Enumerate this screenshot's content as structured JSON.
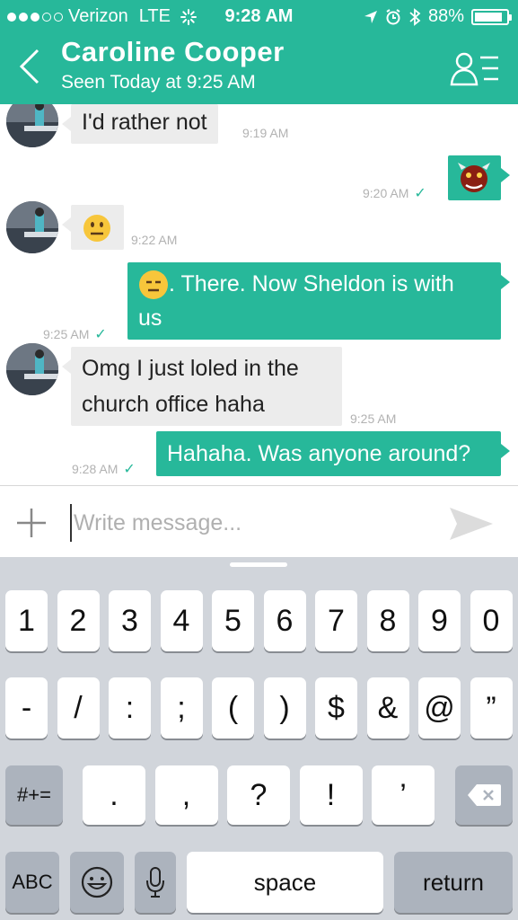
{
  "status_bar": {
    "carrier": "Verizon",
    "network": "LTE",
    "time": "9:28 AM",
    "battery": "88%",
    "battery_level": 0.88
  },
  "header": {
    "title": "Caroline Cooper",
    "subtitle": "Seen Today at 9:25 AM"
  },
  "messages": [
    {
      "direction": "in",
      "text": "I'd rather not",
      "time": "9:19 AM"
    },
    {
      "direction": "out",
      "emoji": "ogre-emoji",
      "time": "9:20 AM"
    },
    {
      "direction": "in",
      "emoji": "neutral-face-emoji",
      "time": "9:22 AM"
    },
    {
      "direction": "out",
      "emoji": "expressionless-face-emoji",
      "line1": ". There. Now Sheldon is with",
      "line2": "us",
      "time": "9:25 AM"
    },
    {
      "direction": "in",
      "line1": "Omg I just loled in the",
      "line2": "church office haha",
      "time": "9:25 AM"
    },
    {
      "direction": "out",
      "text": "Hahaha. Was anyone around?",
      "time": "9:28 AM"
    }
  ],
  "composer": {
    "placeholder": "Write message..."
  },
  "keyboard": {
    "row1": [
      "1",
      "2",
      "3",
      "4",
      "5",
      "6",
      "7",
      "8",
      "9",
      "0"
    ],
    "row2": [
      "-",
      "/",
      ":",
      ";",
      "(",
      ")",
      "$",
      "&",
      "@",
      "”"
    ],
    "row3": [
      ".",
      ",",
      "?",
      "!",
      "’"
    ],
    "symbols_key": "#+=",
    "abc_key": "ABC",
    "space_key": "space",
    "return_key": "return"
  },
  "colors": {
    "accent": "#27b89a",
    "incoming_bubble": "#ececec",
    "keyboard_bg": "#d1d5db"
  }
}
